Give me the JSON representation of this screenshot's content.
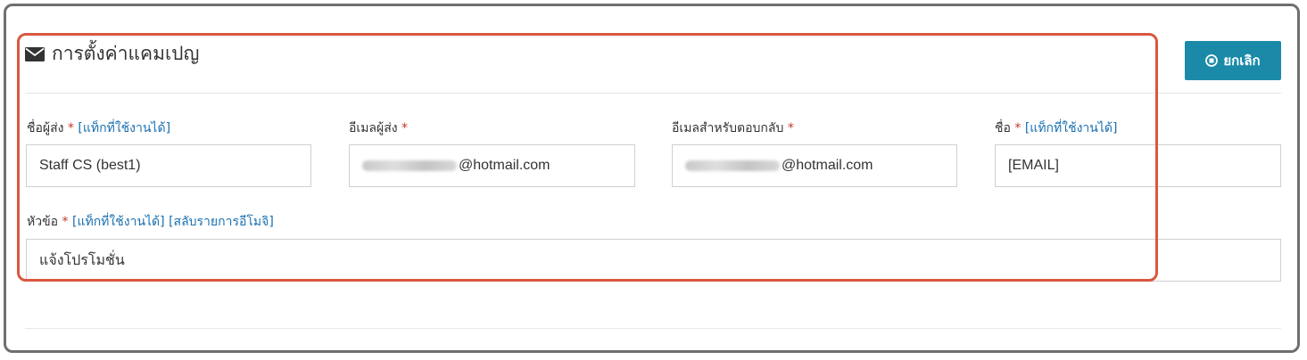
{
  "header": {
    "icon": "envelope-icon",
    "title": "การตั้งค่าแคมเปญ",
    "cancel_label": "ยกเลิก",
    "cancel_icon": "stop-circle-icon",
    "accent": "#1b8aa8"
  },
  "fields": {
    "sender_name": {
      "label": "ชื่อผู้ส่ง",
      "required": "*",
      "tag": "[แท็กที่ใช้งานได้]",
      "value": "Staff CS (best1)"
    },
    "sender_email": {
      "label": "อีเมลผู้ส่ง",
      "required": "*",
      "value_suffix": "@hotmail.com"
    },
    "reply_email": {
      "label": "อีเมลสำหรับตอบกลับ",
      "required": "*",
      "value_suffix": "@hotmail.com"
    },
    "name": {
      "label": "ชื่อ",
      "required": "*",
      "tag": "[แท็กที่ใช้งานได้]",
      "value": "[EMAIL]"
    },
    "subject": {
      "label": "หัวข้อ",
      "required": "*",
      "tag": "[แท็กที่ใช้งานได้]",
      "emoji_tag": "[สลับรายการอีโมจิ]",
      "value": "แจ้งโปรโมชั่น"
    }
  }
}
